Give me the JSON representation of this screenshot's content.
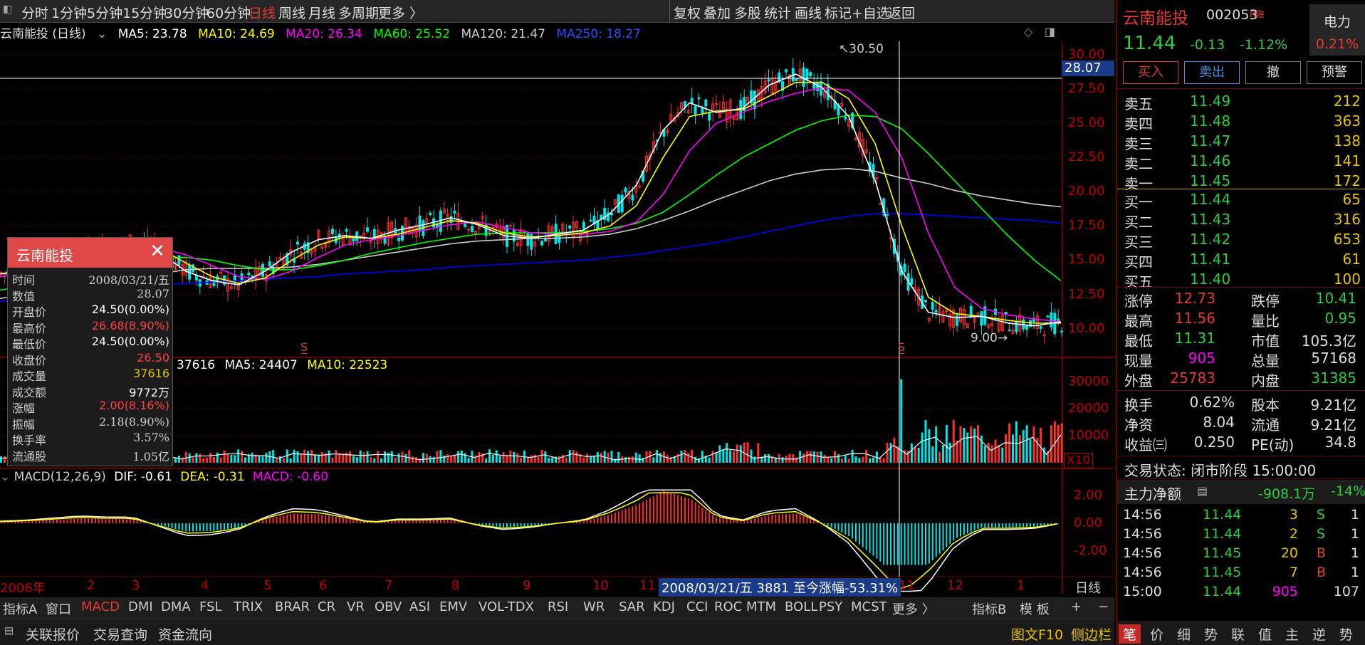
{
  "toolbar": {
    "periods": [
      "分时",
      "1分钟",
      "5分钟",
      "15分钟",
      "30分钟",
      "60分钟",
      "日线",
      "周线",
      "月线",
      "多周期",
      "更多 〉"
    ],
    "right": [
      "复权",
      "叠加",
      "多股",
      "统计",
      "画线",
      "标记",
      "+自选",
      "返回"
    ]
  },
  "legend": {
    "title": "云南能投 (日线)",
    "ma5": "MA5: 23.78",
    "ma10": "MA10: 24.69",
    "ma20": "MA20: 26.34",
    "ma60": "MA60: 25.52",
    "ma120": "MA120: 21.47",
    "ma250": "MA250: 18.27"
  },
  "colors": {
    "ma5": "#ffffff",
    "ma10": "#ffff00",
    "ma20": "#ff00ff",
    "ma60": "#00ff00",
    "ma120": "#cccccc",
    "ma250": "#0000ff",
    "up": "#ff3030",
    "down": "#00e5e5",
    "axis": "#c00000"
  },
  "price_axis": [
    "30.00",
    "27.50",
    "25.00",
    "22.50",
    "20.00",
    "17.50",
    "15.00",
    "12.50",
    "10.00"
  ],
  "crosshair_price": "28.07",
  "high_label": "30.50",
  "low_label": "9.00",
  "vol_legend": {
    "vol": "37616",
    "ma5": "MA5: 24407",
    "ma10": "MA10: 22523"
  },
  "vol_axis": [
    "30000",
    "20000",
    "10000"
  ],
  "vol_unit": "X10",
  "macd_legend": {
    "name": "MACD(12,26,9)",
    "dif": "DIF: -0.61",
    "dea": "DEA: -0.31",
    "macd": "MACD: -0.60"
  },
  "macd_axis": [
    "2.00",
    "0.00",
    "-2.00"
  ],
  "months": [
    "2006年",
    "2",
    "3",
    "4",
    "5",
    "6",
    "7",
    "8",
    "9",
    "10",
    "11",
    "11",
    "12",
    "1"
  ],
  "period_label": "日线",
  "status_bar": "2008/03/21/五 3881 至今涨幅-53.31%",
  "popup": {
    "title": "云南能投",
    "rows": [
      [
        "时间",
        "2008/03/21/五"
      ],
      [
        "数值",
        "28.07"
      ],
      [
        "开盘价",
        "24.50(0.00%)"
      ],
      [
        "最高价",
        "26.68(8.90%)"
      ],
      [
        "最低价",
        "24.50(0.00%)"
      ],
      [
        "收盘价",
        "26.50"
      ],
      [
        "成交量",
        "37616"
      ],
      [
        "成交额",
        "9772万"
      ],
      [
        "涨幅",
        "2.00(8.16%)"
      ],
      [
        "振幅",
        "2.18(8.90%)"
      ],
      [
        "换手率",
        "3.57%"
      ],
      [
        "流通股",
        "1.05亿"
      ]
    ]
  },
  "indicators": [
    "指标A",
    "窗口",
    "MACD",
    "DMI",
    "DMA",
    "FSL",
    "TRIX",
    "BRAR",
    "CR",
    "VR",
    "OBV",
    "ASI",
    "EMV",
    "VOL-TDX",
    "RSI",
    "WR",
    "SAR",
    "KDJ",
    "CCI",
    "ROC",
    "MTM",
    "BOLL",
    "PSY",
    "MCST",
    "更多 〉",
    "指标B",
    "模 板",
    "+",
    "−"
  ],
  "bottom_links": [
    "关联报价",
    "交易查询",
    "资金流向",
    "图文F10",
    "侧边栏"
  ],
  "quote": {
    "name": "云南能投",
    "code": "002053",
    "rz": "R融",
    "price": "11.44",
    "change": "-0.13",
    "pct": "-1.12%",
    "sector": "电力",
    "sector_pct": "0.21%"
  },
  "order_buttons": [
    "买入",
    "卖出",
    "撤",
    "预警"
  ],
  "asks": [
    [
      "卖五",
      "11.49",
      "212"
    ],
    [
      "卖四",
      "11.48",
      "363"
    ],
    [
      "卖三",
      "11.47",
      "138"
    ],
    [
      "卖二",
      "11.46",
      "141"
    ],
    [
      "卖一",
      "11.45",
      "172"
    ]
  ],
  "bids": [
    [
      "买一",
      "11.44",
      "65"
    ],
    [
      "买二",
      "11.43",
      "316"
    ],
    [
      "买三",
      "11.42",
      "653"
    ],
    [
      "买四",
      "11.41",
      "61"
    ],
    [
      "买五",
      "11.40",
      "100"
    ]
  ],
  "stats": [
    [
      "涨停",
      "12.73",
      "跌停",
      "10.41"
    ],
    [
      "最高",
      "11.56",
      "量比",
      "0.95"
    ],
    [
      "最低",
      "11.31",
      "市值",
      "105.3亿"
    ],
    [
      "现量",
      "905",
      "总量",
      "57168"
    ],
    [
      "外盘",
      "25783",
      "内盘",
      "31385"
    ]
  ],
  "stats2": [
    [
      "换手",
      "0.62%",
      "股本",
      "9.21亿"
    ],
    [
      "净资",
      "8.04",
      "流通",
      "9.21亿"
    ],
    [
      "收益㈢",
      "0.250",
      "PE(动)",
      "34.8"
    ]
  ],
  "trade_status": "交易状态: 闭市阶段 15:00:00",
  "net_flow": {
    "label": "主力净额",
    "value": "-908.1万",
    "pct": "-14%"
  },
  "ticks": [
    [
      "14:56",
      "11.44",
      "3",
      "S",
      "1"
    ],
    [
      "14:56",
      "11.44",
      "2",
      "S",
      "1"
    ],
    [
      "14:56",
      "11.45",
      "20",
      "B",
      "1"
    ],
    [
      "14:56",
      "11.45",
      "7",
      "B",
      "1"
    ],
    [
      "15:00",
      "11.44",
      "905",
      "",
      "107"
    ]
  ],
  "panel_tabs": [
    "笔",
    "价",
    "细",
    "势",
    "联",
    "值",
    "主",
    "逆",
    "势"
  ],
  "chart_data": {
    "type": "line",
    "title": "云南能投 (日线)",
    "note": "daily candlestick price series with MA lines",
    "ylim": [
      8,
      31
    ],
    "ma5": [
      14,
      14.3,
      14.8,
      15.5,
      15.8,
      16.3,
      15.6,
      14.2,
      13.5,
      13.2,
      14.2,
      15.6,
      16.5,
      16.8,
      16.6,
      17.2,
      17.6,
      18.1,
      17.6,
      16.8,
      16.6,
      16.9,
      17.2,
      18.4,
      20.5,
      24.5,
      26.5,
      25.8,
      26.1,
      27.8,
      28.6,
      27.6,
      25.5,
      20.8,
      14.2,
      11.2,
      10.8,
      10.9,
      10.4,
      10.2,
      10.5
    ],
    "ma10": [
      14,
      14.2,
      14.6,
      15.2,
      15.7,
      16.1,
      15.9,
      14.8,
      13.8,
      13.3,
      13.7,
      15,
      16.1,
      16.7,
      16.6,
      16.9,
      17.4,
      17.9,
      17.7,
      17,
      16.7,
      16.8,
      17,
      17.5,
      19,
      22.5,
      25.5,
      25.9,
      26,
      27,
      28,
      28,
      26.8,
      23.5,
      17.5,
      12.3,
      11.1,
      10.9,
      10.6,
      10.4,
      10.4
    ],
    "ma20": [
      13.8,
      14,
      14.3,
      14.8,
      15.2,
      15.7,
      15.9,
      15.4,
      14.6,
      13.8,
      13.6,
      14.2,
      15.2,
      16.1,
      16.5,
      16.8,
      17.2,
      17.6,
      17.8,
      17.4,
      17,
      16.9,
      16.9,
      17.1,
      17.8,
      19.8,
      23,
      25,
      25.8,
      26.6,
      27.2,
      27.6,
      27.4,
      25.8,
      22.5,
      17,
      13,
      11.5,
      11,
      10.7,
      10.5
    ],
    "ma60": [
      12.8,
      13.2,
      13.6,
      14,
      14.4,
      14.8,
      15.1,
      15.2,
      15,
      14.6,
      14.3,
      14.3,
      14.6,
      15,
      15.5,
      15.9,
      16.3,
      16.6,
      16.9,
      17,
      17,
      17,
      17.1,
      17.3,
      17.7,
      18.5,
      19.8,
      21.2,
      22.5,
      23.5,
      24.5,
      25.2,
      25.6,
      25.5,
      24.6,
      22.8,
      20.8,
      18.8,
      16.8,
      15,
      13.5
    ],
    "ma120": [
      12.2,
      12.5,
      12.8,
      13.1,
      13.4,
      13.7,
      14,
      14.3,
      14.4,
      14.4,
      14.4,
      14.5,
      14.7,
      15,
      15.3,
      15.6,
      15.9,
      16.2,
      16.4,
      16.5,
      16.6,
      16.6,
      16.7,
      16.9,
      17.3,
      17.9,
      18.6,
      19.4,
      20.1,
      20.8,
      21.3,
      21.6,
      21.7,
      21.5,
      21,
      20.6,
      20.1,
      19.7,
      19.4,
      19.1,
      18.9
    ],
    "ma250": [
      12,
      12.2,
      12.4,
      12.6,
      12.8,
      13,
      13.2,
      13.3,
      13.4,
      13.5,
      13.6,
      13.7,
      13.8,
      14,
      14.1,
      14.2,
      14.3,
      14.5,
      14.6,
      14.7,
      14.8,
      14.9,
      15,
      15.2,
      15.4,
      15.7,
      16,
      16.3,
      16.7,
      17.1,
      17.5,
      17.9,
      18.2,
      18.4,
      18.4,
      18.3,
      18.2,
      18.1,
      18,
      17.9,
      17.7
    ]
  }
}
